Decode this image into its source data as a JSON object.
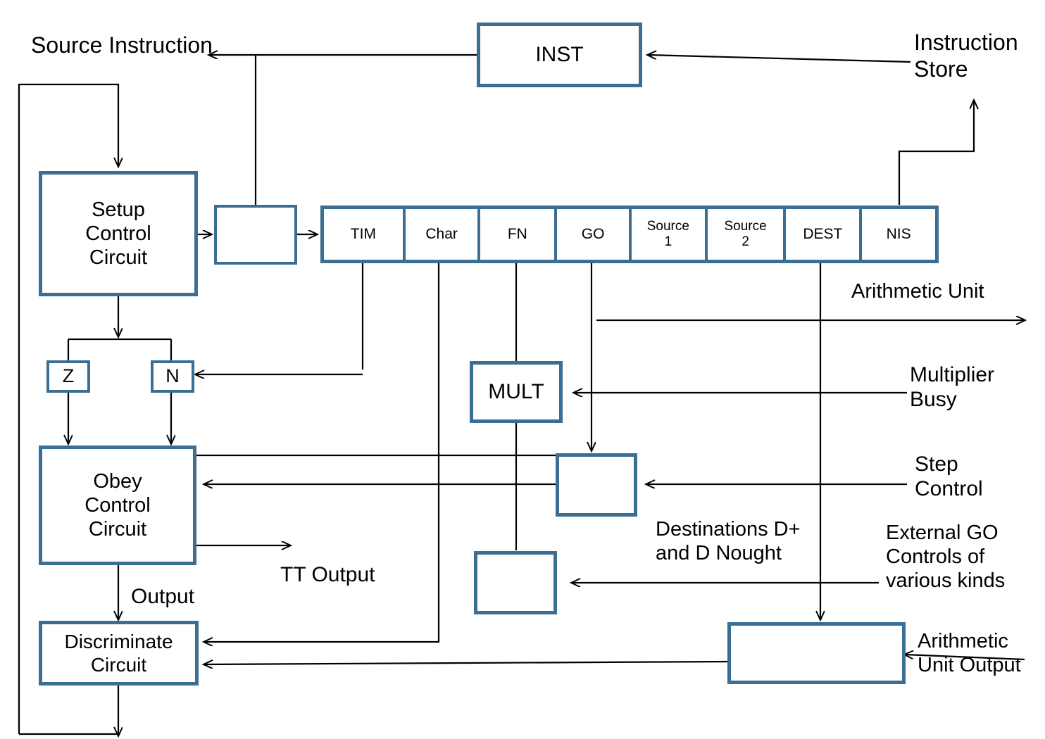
{
  "diagram": {
    "title": "Computer Control Unit Block Diagram",
    "accent_color": "#3c6d92",
    "line_color": "#000000",
    "background": "#ffffff"
  },
  "boxes": {
    "inst": "INST",
    "setup_control": "Setup\nControl\nCircuit",
    "staging": "",
    "obey_control": "Obey\nControl\nCircuit",
    "discriminate": "Discriminate\nCircuit",
    "mult": "MULT",
    "z": "Z",
    "n": "N",
    "step_control_box": "",
    "lower_small_box": "",
    "arith_output_box": ""
  },
  "registers": {
    "cells": [
      {
        "label": "TIM"
      },
      {
        "label": "Char"
      },
      {
        "label": "FN"
      },
      {
        "label": "GO"
      },
      {
        "label": "Source\n1"
      },
      {
        "label": "Source\n2"
      },
      {
        "label": "DEST"
      },
      {
        "label": "NIS"
      }
    ]
  },
  "labels": {
    "source_instruction": "Source Instruction",
    "instruction_store": "Instruction\nStore",
    "arithmetic_unit": "Arithmetic Unit",
    "multiplier_busy": "Multiplier\nBusy",
    "step_control": "Step\nControl",
    "destinations": "Destinations D+\nand D Nought",
    "external_go": "External GO\nControls of\nvarious kinds",
    "arithmetic_unit_output": "Arithmetic\nUnit Output",
    "tt_output": "TT Output",
    "output": "Output"
  }
}
